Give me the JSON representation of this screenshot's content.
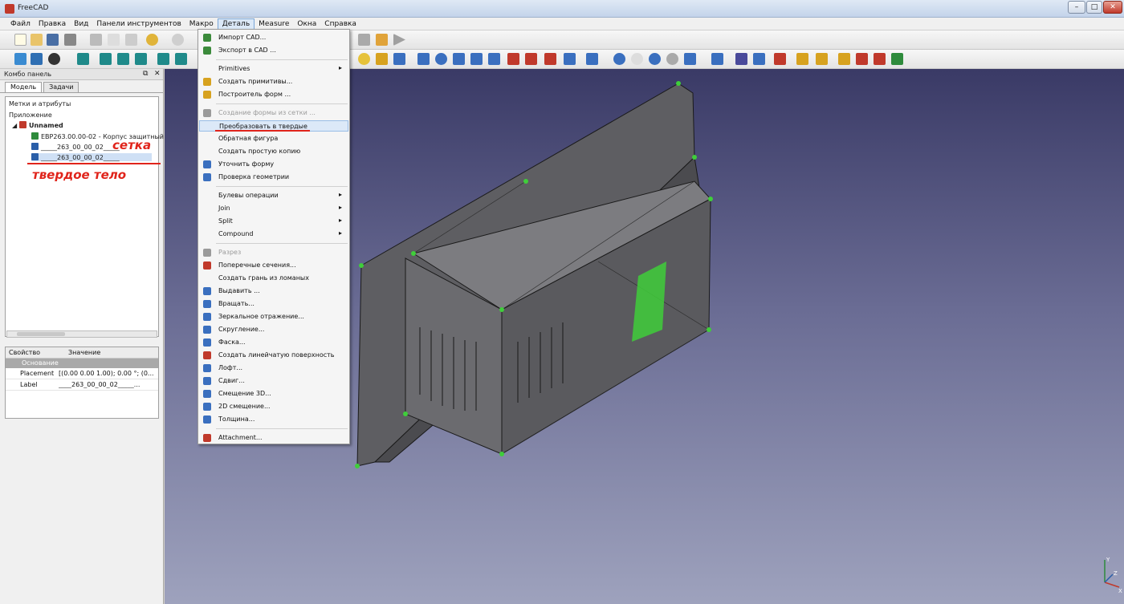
{
  "window": {
    "title": "FreeCAD",
    "min": "–",
    "max": "□",
    "close": "✕"
  },
  "menubar": [
    "Файл",
    "Правка",
    "Вид",
    "Панели инструментов",
    "Макро",
    "Деталь",
    "Measure",
    "Окна",
    "Справка"
  ],
  "combo": {
    "title": "Комбо панель",
    "tabs": [
      "Модель",
      "Задачи"
    ],
    "section_labels": "Метки и атрибуты",
    "app_label": "Приложение",
    "tree": [
      {
        "label": "Unnamed",
        "icon_color": "#c0392b",
        "indent": 0,
        "expander": "◢"
      },
      {
        "label": "EBP263.00.00-02 - Корпус защитный",
        "icon_color": "#2e8b3c",
        "indent": 1
      },
      {
        "label": "_____263_00_00_02_____",
        "icon_color": "#2a5ea8",
        "indent": 1
      },
      {
        "label": "_____263_00_00_02_____",
        "icon_color": "#2a5ea8",
        "indent": 1,
        "selected": true
      }
    ],
    "properties": {
      "headers": [
        "Свойство",
        "Значение"
      ],
      "group": "Основание",
      "rows": [
        {
          "key": "Placement",
          "value": "[(0.00 0.00 1.00); 0.00 °; (0..."
        },
        {
          "key": "Label",
          "value": "____263_00_00_02_____..."
        }
      ]
    }
  },
  "dropdown": {
    "items": [
      {
        "label": "Импорт CAD...",
        "icon": "import-cad-icon",
        "color": "#3b8a3b"
      },
      {
        "label": "Экспорт в CAD ...",
        "icon": "export-cad-icon",
        "color": "#3b8a3b"
      },
      {
        "sep": true
      },
      {
        "label": "Primitives",
        "submenu": true
      },
      {
        "label": "Создать примитивы...",
        "icon": "primitives-icon",
        "color": "#d7a21f"
      },
      {
        "label": "Построитель форм ...",
        "icon": "shape-builder-icon",
        "color": "#d7a21f"
      },
      {
        "sep": true
      },
      {
        "label": "Создание формы из сетки ...",
        "icon": "shape-from-mesh-icon",
        "color": "#9a9a9a",
        "disabled": true
      },
      {
        "label": "Преобразовать в твердые",
        "highlight": true
      },
      {
        "label": "Обратная фигура"
      },
      {
        "label": "Создать простую копию"
      },
      {
        "label": "Уточнить форму",
        "icon": "refine-shape-icon",
        "color": "#3a6fbf"
      },
      {
        "label": "Проверка геометрии",
        "icon": "check-geometry-icon",
        "color": "#3a6fbf"
      },
      {
        "sep": true
      },
      {
        "label": "Булевы операции",
        "submenu": true
      },
      {
        "label": "Join",
        "submenu": true
      },
      {
        "label": "Split",
        "submenu": true
      },
      {
        "label": "Compound",
        "submenu": true
      },
      {
        "sep": true
      },
      {
        "label": "Разрез",
        "icon": "section-icon",
        "color": "#9a9a9a",
        "disabled": true
      },
      {
        "label": "Поперечные сечения...",
        "icon": "cross-sections-icon",
        "color": "#c0392b"
      },
      {
        "label": "Создать грань из ломаных"
      },
      {
        "label": "Выдавить ...",
        "icon": "extrude-icon",
        "color": "#3a6fbf"
      },
      {
        "label": "Вращать...",
        "icon": "revolve-icon",
        "color": "#3a6fbf"
      },
      {
        "label": "Зеркальное отражение...",
        "icon": "mirror-icon",
        "color": "#3a6fbf"
      },
      {
        "label": "Скругление...",
        "icon": "fillet-icon",
        "color": "#3a6fbf"
      },
      {
        "label": "Фаска...",
        "icon": "chamfer-icon",
        "color": "#3a6fbf"
      },
      {
        "label": "Создать линейчатую поверхность",
        "icon": "ruled-surface-icon",
        "color": "#c0392b"
      },
      {
        "label": "Лофт...",
        "icon": "loft-icon",
        "color": "#3a6fbf"
      },
      {
        "label": "Сдвиг...",
        "icon": "sweep-icon",
        "color": "#3a6fbf"
      },
      {
        "label": "Смещение 3D...",
        "icon": "offset3d-icon",
        "color": "#3a6fbf"
      },
      {
        "label": "2D смещение...",
        "icon": "offset2d-icon",
        "color": "#3a6fbf"
      },
      {
        "label": "Толщина...",
        "icon": "thickness-icon",
        "color": "#3a6fbf"
      },
      {
        "sep": true
      },
      {
        "label": "Attachment...",
        "icon": "attachment-icon",
        "color": "#c0392b"
      }
    ]
  },
  "annotations": {
    "setka": "сетка",
    "tverd": "твердое тело"
  },
  "axis": {
    "y": "Y",
    "z": "Z",
    "x": "X"
  }
}
